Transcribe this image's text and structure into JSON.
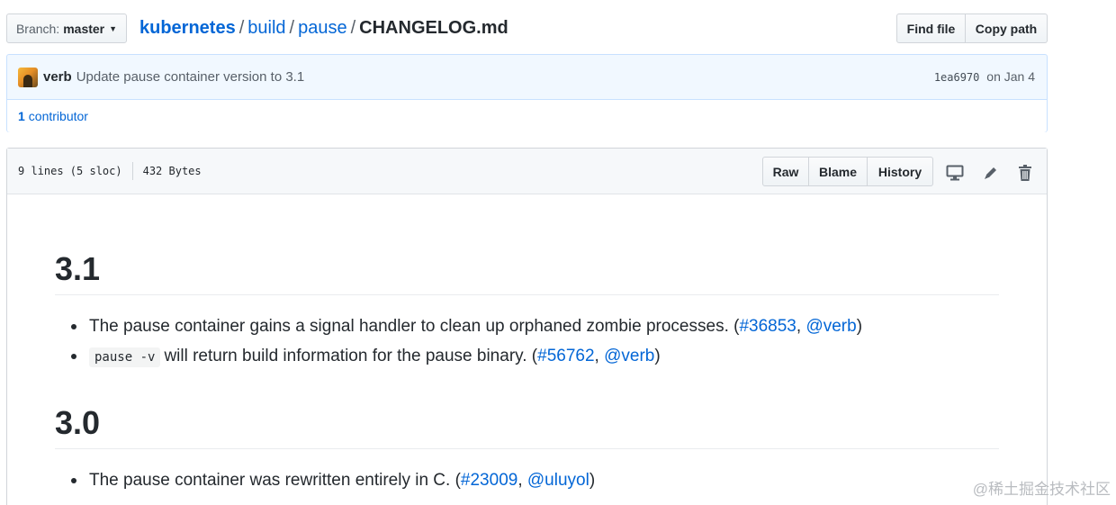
{
  "branch": {
    "label": "Branch:",
    "name": "master"
  },
  "breadcrumb": {
    "repo": "kubernetes",
    "dirs": [
      "build",
      "pause"
    ],
    "file": "CHANGELOG.md",
    "separator": "/"
  },
  "file_nav": {
    "find_file": "Find file",
    "copy_path": "Copy path"
  },
  "commit": {
    "author": "verb",
    "message": "Update pause container version to 3.1",
    "sha": "1ea6970",
    "date": "on Jan 4"
  },
  "contributors": {
    "count": "1",
    "label": "contributor"
  },
  "file": {
    "lines": "9 lines (5 sloc)",
    "size": "432 Bytes",
    "actions": {
      "raw": "Raw",
      "blame": "Blame",
      "history": "History"
    },
    "icons": [
      "desktop-icon",
      "pencil-icon",
      "trash-icon"
    ]
  },
  "markdown": {
    "sections": [
      {
        "heading": "3.1",
        "items": [
          {
            "code": "",
            "text": "The pause container gains a signal handler to clean up orphaned zombie processes. (",
            "link1": "#36853",
            "comma": ", ",
            "link2": "@verb",
            "close": ")"
          },
          {
            "code": "pause -v",
            "text": "will return build information for the pause binary. (",
            "link1": "#56762",
            "comma": ", ",
            "link2": "@verb",
            "close": ")"
          }
        ]
      },
      {
        "heading": "3.0",
        "items": [
          {
            "code": "",
            "text": "The pause container was rewritten entirely in C. (",
            "link1": "#23009",
            "comma": ", ",
            "link2": "@uluyol",
            "close": ")"
          }
        ]
      }
    ]
  },
  "watermark": "@稀土掘金技术社区",
  "colors": {
    "link": "#0366d6",
    "commit_bg": "#f1f8ff",
    "commit_border": "#c8e1ff"
  }
}
